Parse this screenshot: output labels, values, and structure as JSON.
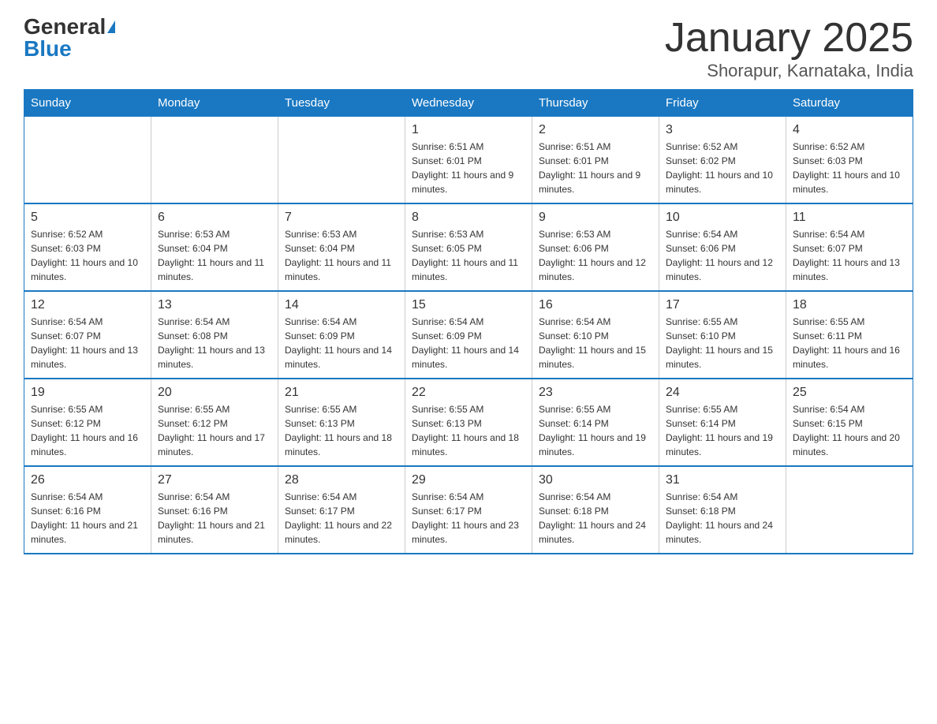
{
  "header": {
    "logo_general": "General",
    "logo_blue": "Blue",
    "month_title": "January 2025",
    "location": "Shorapur, Karnataka, India"
  },
  "days_of_week": [
    "Sunday",
    "Monday",
    "Tuesday",
    "Wednesday",
    "Thursday",
    "Friday",
    "Saturday"
  ],
  "weeks": [
    [
      {
        "day": "",
        "info": ""
      },
      {
        "day": "",
        "info": ""
      },
      {
        "day": "",
        "info": ""
      },
      {
        "day": "1",
        "info": "Sunrise: 6:51 AM\nSunset: 6:01 PM\nDaylight: 11 hours and 9 minutes."
      },
      {
        "day": "2",
        "info": "Sunrise: 6:51 AM\nSunset: 6:01 PM\nDaylight: 11 hours and 9 minutes."
      },
      {
        "day": "3",
        "info": "Sunrise: 6:52 AM\nSunset: 6:02 PM\nDaylight: 11 hours and 10 minutes."
      },
      {
        "day": "4",
        "info": "Sunrise: 6:52 AM\nSunset: 6:03 PM\nDaylight: 11 hours and 10 minutes."
      }
    ],
    [
      {
        "day": "5",
        "info": "Sunrise: 6:52 AM\nSunset: 6:03 PM\nDaylight: 11 hours and 10 minutes."
      },
      {
        "day": "6",
        "info": "Sunrise: 6:53 AM\nSunset: 6:04 PM\nDaylight: 11 hours and 11 minutes."
      },
      {
        "day": "7",
        "info": "Sunrise: 6:53 AM\nSunset: 6:04 PM\nDaylight: 11 hours and 11 minutes."
      },
      {
        "day": "8",
        "info": "Sunrise: 6:53 AM\nSunset: 6:05 PM\nDaylight: 11 hours and 11 minutes."
      },
      {
        "day": "9",
        "info": "Sunrise: 6:53 AM\nSunset: 6:06 PM\nDaylight: 11 hours and 12 minutes."
      },
      {
        "day": "10",
        "info": "Sunrise: 6:54 AM\nSunset: 6:06 PM\nDaylight: 11 hours and 12 minutes."
      },
      {
        "day": "11",
        "info": "Sunrise: 6:54 AM\nSunset: 6:07 PM\nDaylight: 11 hours and 13 minutes."
      }
    ],
    [
      {
        "day": "12",
        "info": "Sunrise: 6:54 AM\nSunset: 6:07 PM\nDaylight: 11 hours and 13 minutes."
      },
      {
        "day": "13",
        "info": "Sunrise: 6:54 AM\nSunset: 6:08 PM\nDaylight: 11 hours and 13 minutes."
      },
      {
        "day": "14",
        "info": "Sunrise: 6:54 AM\nSunset: 6:09 PM\nDaylight: 11 hours and 14 minutes."
      },
      {
        "day": "15",
        "info": "Sunrise: 6:54 AM\nSunset: 6:09 PM\nDaylight: 11 hours and 14 minutes."
      },
      {
        "day": "16",
        "info": "Sunrise: 6:54 AM\nSunset: 6:10 PM\nDaylight: 11 hours and 15 minutes."
      },
      {
        "day": "17",
        "info": "Sunrise: 6:55 AM\nSunset: 6:10 PM\nDaylight: 11 hours and 15 minutes."
      },
      {
        "day": "18",
        "info": "Sunrise: 6:55 AM\nSunset: 6:11 PM\nDaylight: 11 hours and 16 minutes."
      }
    ],
    [
      {
        "day": "19",
        "info": "Sunrise: 6:55 AM\nSunset: 6:12 PM\nDaylight: 11 hours and 16 minutes."
      },
      {
        "day": "20",
        "info": "Sunrise: 6:55 AM\nSunset: 6:12 PM\nDaylight: 11 hours and 17 minutes."
      },
      {
        "day": "21",
        "info": "Sunrise: 6:55 AM\nSunset: 6:13 PM\nDaylight: 11 hours and 18 minutes."
      },
      {
        "day": "22",
        "info": "Sunrise: 6:55 AM\nSunset: 6:13 PM\nDaylight: 11 hours and 18 minutes."
      },
      {
        "day": "23",
        "info": "Sunrise: 6:55 AM\nSunset: 6:14 PM\nDaylight: 11 hours and 19 minutes."
      },
      {
        "day": "24",
        "info": "Sunrise: 6:55 AM\nSunset: 6:14 PM\nDaylight: 11 hours and 19 minutes."
      },
      {
        "day": "25",
        "info": "Sunrise: 6:54 AM\nSunset: 6:15 PM\nDaylight: 11 hours and 20 minutes."
      }
    ],
    [
      {
        "day": "26",
        "info": "Sunrise: 6:54 AM\nSunset: 6:16 PM\nDaylight: 11 hours and 21 minutes."
      },
      {
        "day": "27",
        "info": "Sunrise: 6:54 AM\nSunset: 6:16 PM\nDaylight: 11 hours and 21 minutes."
      },
      {
        "day": "28",
        "info": "Sunrise: 6:54 AM\nSunset: 6:17 PM\nDaylight: 11 hours and 22 minutes."
      },
      {
        "day": "29",
        "info": "Sunrise: 6:54 AM\nSunset: 6:17 PM\nDaylight: 11 hours and 23 minutes."
      },
      {
        "day": "30",
        "info": "Sunrise: 6:54 AM\nSunset: 6:18 PM\nDaylight: 11 hours and 24 minutes."
      },
      {
        "day": "31",
        "info": "Sunrise: 6:54 AM\nSunset: 6:18 PM\nDaylight: 11 hours and 24 minutes."
      },
      {
        "day": "",
        "info": ""
      }
    ]
  ]
}
